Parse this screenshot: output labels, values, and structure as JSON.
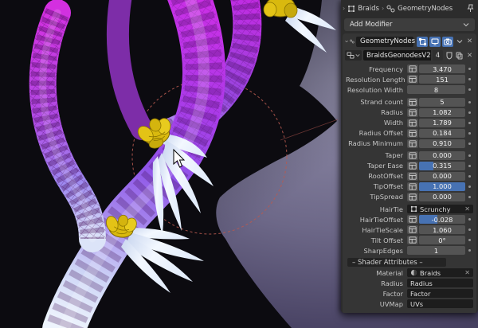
{
  "breadcrumb": {
    "expand": "›",
    "object": "Braids",
    "separator": "›",
    "modifier": "GeometryNodes"
  },
  "add_modifier_label": "Add Modifier",
  "modifier": {
    "name": "GeometryNodes",
    "node_tree_name": "BraidsGeonodesV2",
    "users_count": "4",
    "rows": [
      {
        "label": "Frequency",
        "value": "3.470",
        "type": "number",
        "attr": true,
        "dot": true
      },
      {
        "label": "Resolution Length",
        "value": "151",
        "type": "number",
        "attr": true,
        "dot": true
      },
      {
        "label": "Resolution Width",
        "value": "8",
        "type": "number",
        "attr": false,
        "dot": true
      },
      {
        "label": "Strand count",
        "value": "5",
        "type": "number",
        "attr": true,
        "dot": true,
        "gap": true
      },
      {
        "label": "Radius",
        "value": "1.082",
        "type": "number",
        "attr": true,
        "dot": true
      },
      {
        "label": "Width",
        "value": "1.789",
        "type": "number",
        "attr": true,
        "dot": true
      },
      {
        "label": "Radius Offset",
        "value": "0.184",
        "type": "number",
        "attr": true,
        "dot": true
      },
      {
        "label": "Radius Minimum",
        "value": "0.910",
        "type": "number",
        "attr": true,
        "dot": true
      },
      {
        "label": "Taper",
        "value": "0.000",
        "type": "number",
        "attr": true,
        "dot": true,
        "gap": true
      },
      {
        "label": "Taper Ease",
        "value": "0.315",
        "type": "slider",
        "fill": 0.315,
        "attr": true,
        "dot": true
      },
      {
        "label": "RootOffset",
        "value": "0.000",
        "type": "number",
        "attr": true,
        "dot": true
      },
      {
        "label": "TipOffset",
        "value": "1.000",
        "type": "slider",
        "fill": 1.0,
        "attr": true,
        "dot": true
      },
      {
        "label": "TipSpread",
        "value": "0.000",
        "type": "number",
        "attr": true,
        "dot": true
      },
      {
        "label": "HairTie",
        "value": "Scrunchy",
        "type": "object",
        "icon": "object-icon",
        "clearable": true,
        "gap": true
      },
      {
        "label": "HairTieOffset",
        "value": "-0.028",
        "type": "slider",
        "fill": 0.4,
        "attr": true,
        "dot": true
      },
      {
        "label": "HairTieScale",
        "value": "1.060",
        "type": "number",
        "attr": true,
        "dot": true
      },
      {
        "label": "Tilt Offset",
        "value": "0°",
        "type": "number",
        "attr": true,
        "dot": true
      },
      {
        "label": "SharpEdges",
        "value": "1",
        "type": "number",
        "attr": false,
        "dot": true
      },
      {
        "label": "",
        "value": "– Shader Attributes –",
        "type": "separator",
        "gap": true
      },
      {
        "label": "Material",
        "value": "Braids",
        "type": "material",
        "icon": "material-icon",
        "clearable": true
      },
      {
        "label": "Radius",
        "value": "Radius",
        "type": "string"
      },
      {
        "label": "Factor",
        "value": "Factor",
        "type": "string"
      },
      {
        "label": "UVMap",
        "value": "UVs",
        "type": "string"
      }
    ]
  },
  "icons": {
    "pin": "pin-icon",
    "object": "object-icon",
    "geometry_nodes": "geometry-nodes-icon",
    "edit_mode": "edit-mode-toggle-icon",
    "realtime": "realtime-display-icon",
    "render": "render-display-icon",
    "fake_user": "fake-user-shield-icon",
    "duplicate": "duplicate-icon",
    "close": "close-icon",
    "attribute_toggle": "attribute-input-toggle-icon"
  },
  "colors": {
    "accent": "#4772b3",
    "panel_bg": "#2c2c2c",
    "field": "#545454",
    "field_dark": "#1d1d1d",
    "viewport_light": "#928fab",
    "viewport_dark": "#332e4a",
    "silhouette": "#0c0b10",
    "braid_magenta": "#cb2fe6",
    "braid_purple": "#8f55e8",
    "braid_tip": "#eef4fd",
    "scrunchy_yellow": "#e3c316",
    "empty_circle": "#b85a50"
  },
  "glyphs": {
    "x": "✕",
    "chev_down": "⌄"
  }
}
